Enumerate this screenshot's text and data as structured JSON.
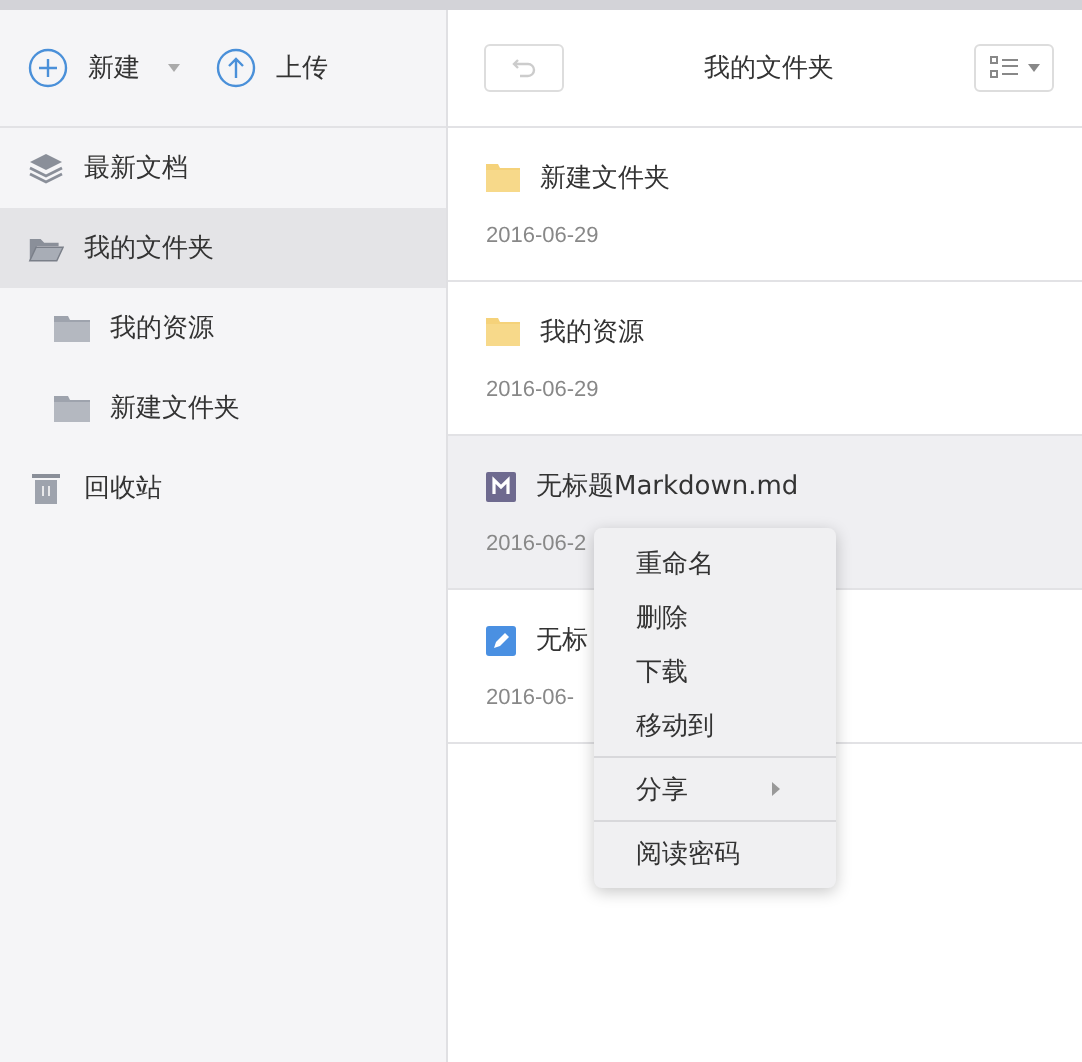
{
  "toolbar": {
    "new_label": "新建",
    "upload_label": "上传"
  },
  "sidebar": {
    "items": [
      {
        "label": "最新文档",
        "kind": "layers",
        "selected": false
      },
      {
        "label": "我的文件夹",
        "kind": "folder-open",
        "selected": true,
        "children": [
          {
            "label": "我的资源",
            "kind": "folder",
            "selected": false
          },
          {
            "label": "新建文件夹",
            "kind": "folder",
            "selected": false
          }
        ]
      },
      {
        "label": "回收站",
        "kind": "trash",
        "selected": false
      }
    ]
  },
  "header": {
    "title": "我的文件夹"
  },
  "files": [
    {
      "name": "新建文件夹",
      "kind": "folder",
      "date": "2016-06-29",
      "selected": false
    },
    {
      "name": "我的资源",
      "kind": "folder",
      "date": "2016-06-29",
      "selected": false
    },
    {
      "name": "无标题Markdown.md",
      "kind": "markdown",
      "date": "2016-06-2",
      "selected": true
    },
    {
      "name": "无标",
      "kind": "note",
      "date": "2016-06-",
      "selected": false
    }
  ],
  "context_menu": {
    "groups": [
      [
        {
          "label": "重命名",
          "has_submenu": false
        },
        {
          "label": "删除",
          "has_submenu": false
        },
        {
          "label": "下载",
          "has_submenu": false
        },
        {
          "label": "移动到",
          "has_submenu": false
        }
      ],
      [
        {
          "label": "分享",
          "has_submenu": true
        }
      ],
      [
        {
          "label": "阅读密码",
          "has_submenu": false
        }
      ]
    ]
  }
}
